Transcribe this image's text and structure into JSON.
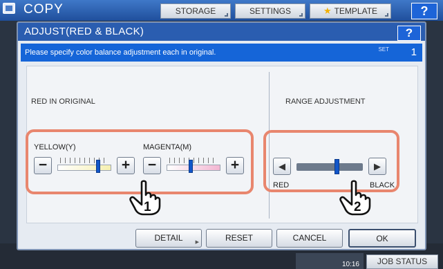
{
  "app": {
    "title": "COPY",
    "tabs": [
      {
        "label": "STORAGE"
      },
      {
        "label": "SETTINGS"
      },
      {
        "label": "TEMPLATE"
      }
    ],
    "help_label": "?",
    "clock": "10:16",
    "job_status_label": "JOB STATUS"
  },
  "dialog": {
    "title": "ADJUST(RED & BLACK)",
    "help_label": "?",
    "message": "Please specify color balance adjustment each in original.",
    "set_label": "SET",
    "set_count": "1",
    "red_section": {
      "title": "RED IN ORIGINAL",
      "yellow": {
        "label": "YELLOW(Y)",
        "minus": "−",
        "plus": "+",
        "level": 0.78
      },
      "magenta": {
        "label": "MAGENTA(M)",
        "minus": "−",
        "plus": "+",
        "level": 0.45
      }
    },
    "range_section": {
      "title": "RANGE ADJUSTMENT",
      "left_arrow": "◀",
      "right_arrow": "▶",
      "red_label": "RED",
      "black_label": "BLACK",
      "level": 0.62
    },
    "callouts": {
      "one": "1",
      "two": "2"
    },
    "footer": {
      "detail_label": "DETAIL",
      "reset_label": "RESET",
      "cancel_label": "CANCEL",
      "ok_label": "OK"
    }
  },
  "colors": {
    "title_bar": "#2a5db0",
    "message_bar": "#1565d8",
    "highlight": "#e8866e",
    "thumb": "#1256c9"
  }
}
